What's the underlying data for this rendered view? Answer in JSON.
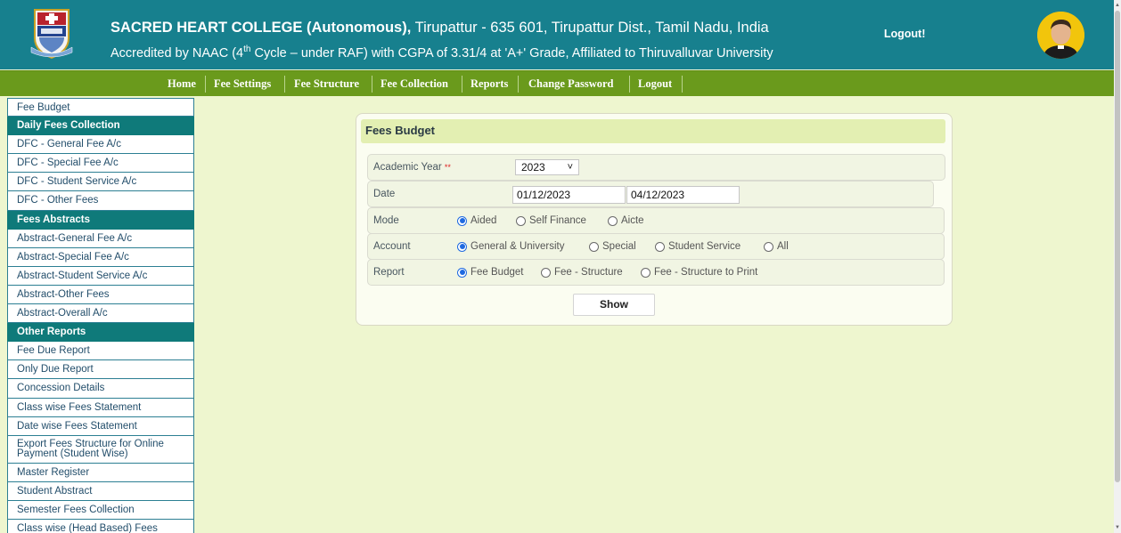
{
  "header": {
    "college_name": "SACRED HEART COLLEGE (Autonomous),",
    "location": " Tirupattur - 635 601, Tirupattur Dist., Tamil Nadu, India",
    "accred_pre": "Accredited by NAAC (4",
    "accred_sup": "th",
    "accred_post": " Cycle – under RAF) with CGPA of 3.31/4 at 'A+' Grade, Affiliated to Thiruvalluvar University",
    "logout_label": "Logout!"
  },
  "nav": {
    "home": "Home",
    "fee_settings": "Fee Settings",
    "fee_structure": "Fee Structure",
    "fee_collection": "Fee Collection",
    "reports": "Reports",
    "change_password": "Change Password",
    "logout": "Logout"
  },
  "sidebar": {
    "items": [
      "Fee Budget",
      "Daily Fees Collection",
      "DFC - General Fee A/c",
      "DFC - Special Fee A/c",
      "DFC - Student Service A/c",
      "DFC - Other Fees",
      "Fees Abstracts",
      "Abstract-General Fee A/c",
      "Abstract-Special Fee A/c",
      "Abstract-Student Service A/c",
      "Abstract-Other Fees",
      "Abstract-Overall A/c",
      "Other Reports",
      "Fee Due Report",
      "Only Due Report",
      "Concession Details",
      "Class wise Fees Statement",
      "Date wise Fees Statement",
      "Export Fees Structure for Online Payment (Student Wise)",
      "Master Register",
      "Student Abstract",
      "Semester Fees Collection",
      "Class wise (Head Based) Fees"
    ]
  },
  "form": {
    "title": "Fees Budget",
    "academic_year_label": "Academic Year",
    "required_mark": "**",
    "academic_year_value": "2023",
    "date_label": "Date",
    "date_from": "01/12/2023",
    "date_to": "04/12/2023",
    "mode_label": "Mode",
    "mode_options": [
      "Aided",
      "Self Finance",
      "Aicte"
    ],
    "mode_selected": "Aided",
    "account_label": "Account",
    "account_options": [
      "General & University",
      "Special",
      "Student Service",
      "All"
    ],
    "account_selected": "General & University",
    "report_label": "Report",
    "report_options": [
      "Fee Budget",
      "Fee - Structure",
      "Fee - Structure to Print"
    ],
    "report_selected": "Fee Budget",
    "show_button": "Show"
  },
  "colors": {
    "header_bg": "#17808e",
    "nav_bg": "#6a9a1c",
    "page_bg": "#eef6cf",
    "sidebar_heading_bg": "#0f7a7a",
    "radio_selected": "#1f6ae0"
  }
}
